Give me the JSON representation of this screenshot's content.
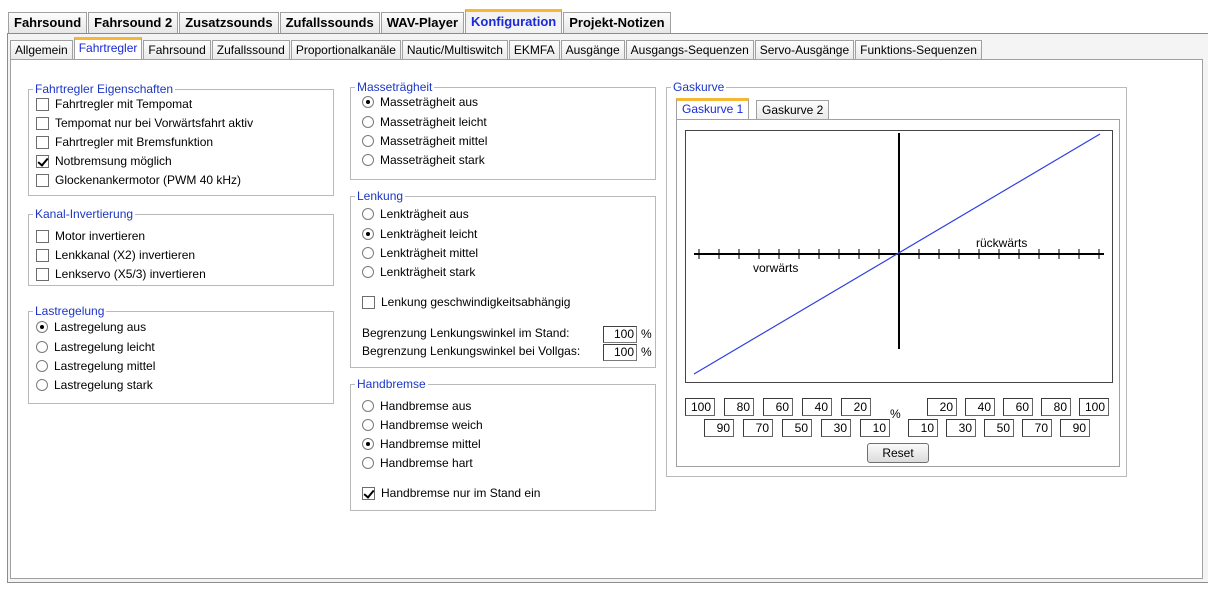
{
  "outer_tabs": [
    "Fahrsound",
    "Fahrsound 2",
    "Zusatzsounds",
    "Zufallssounds",
    "WAV-Player",
    "Konfiguration",
    "Projekt-Notizen"
  ],
  "outer_active": 5,
  "inner_tabs": [
    "Allgemein",
    "Fahrtregler",
    "Fahrsound",
    "Zufallssound",
    "Proportionalkanäle",
    "Nautic/Multiswitch",
    "EKMFA",
    "Ausgänge",
    "Ausgangs-Sequenzen",
    "Servo-Ausgänge",
    "Funktions-Sequenzen"
  ],
  "inner_active": 1,
  "fahrtregler": {
    "title": "Fahrtregler Eigenschaften",
    "items": [
      {
        "label": "Fahrtregler mit Tempomat",
        "checked": false
      },
      {
        "label": "Tempomat nur bei Vorwärtsfahrt aktiv",
        "checked": false
      },
      {
        "label": "Fahrtregler mit Bremsfunktion",
        "checked": false
      },
      {
        "label": "Notbremsung möglich",
        "checked": true
      },
      {
        "label": "Glockenankermotor (PWM 40 kHz)",
        "checked": false
      }
    ]
  },
  "kanal": {
    "title": "Kanal-Invertierung",
    "items": [
      {
        "label": "Motor invertieren",
        "checked": false
      },
      {
        "label": "Lenkkanal (X2) invertieren",
        "checked": false
      },
      {
        "label": "Lenkservo (X5/3) invertieren",
        "checked": false
      }
    ]
  },
  "last": {
    "title": "Lastregelung",
    "items": [
      {
        "label": "Lastregelung aus",
        "selected": true
      },
      {
        "label": "Lastregelung leicht",
        "selected": false
      },
      {
        "label": "Lastregelung mittel",
        "selected": false
      },
      {
        "label": "Lastregelung stark",
        "selected": false
      }
    ]
  },
  "masse": {
    "title": "Masseträgheit",
    "items": [
      {
        "label": "Masseträgheit aus",
        "selected": true
      },
      {
        "label": "Masseträgheit leicht",
        "selected": false
      },
      {
        "label": "Masseträgheit mittel",
        "selected": false
      },
      {
        "label": "Masseträgheit stark",
        "selected": false
      }
    ]
  },
  "lenkung": {
    "title": "Lenkung",
    "items": [
      {
        "label": "Lenkträgheit aus",
        "selected": false
      },
      {
        "label": "Lenkträgheit leicht",
        "selected": true
      },
      {
        "label": "Lenkträgheit mittel",
        "selected": false
      },
      {
        "label": "Lenkträgheit stark",
        "selected": false
      }
    ],
    "geschwindigkeit": {
      "label": "Lenkung geschwindigkeitsabhängig",
      "checked": false
    },
    "stand_label": "Begrenzung Lenkungswinkel im Stand:",
    "stand_value": "100",
    "vollgas_label": "Begrenzung Lenkungswinkel bei Vollgas:",
    "vollgas_value": "100",
    "unit": "%"
  },
  "handbremse": {
    "title": "Handbremse",
    "items": [
      {
        "label": "Handbremse aus",
        "selected": false
      },
      {
        "label": "Handbremse weich",
        "selected": false
      },
      {
        "label": "Handbremse mittel",
        "selected": true
      },
      {
        "label": "Handbremse hart",
        "selected": false
      }
    ],
    "stand": {
      "label": "Handbremse nur im Stand ein",
      "checked": true
    }
  },
  "gaskurve": {
    "title": "Gaskurve",
    "tabs": [
      "Gaskurve 1",
      "Gaskurve 2"
    ],
    "active_tab": 0,
    "label_left": "vorwärts",
    "label_right": "rückwärts",
    "row1_left": [
      "100",
      "80",
      "60",
      "40",
      "20"
    ],
    "row1_right": [
      "20",
      "40",
      "60",
      "80",
      "100"
    ],
    "row2_left": [
      "90",
      "70",
      "50",
      "30",
      "10"
    ],
    "row2_right": [
      "10",
      "30",
      "50",
      "70",
      "90"
    ],
    "unit": "%",
    "reset_label": "Reset",
    "line_color": "#2e3fe0"
  }
}
